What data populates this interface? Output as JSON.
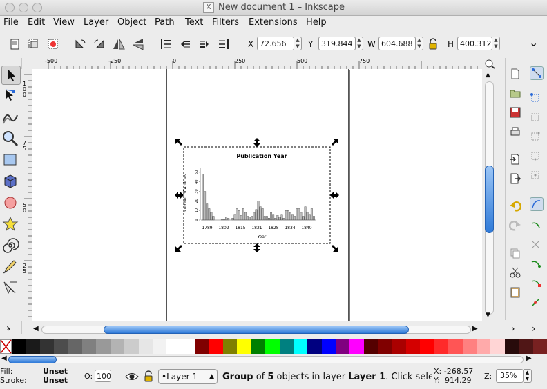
{
  "window": {
    "title": "New document 1 – Inkscape",
    "x11_badge": "X"
  },
  "menu": {
    "items": [
      {
        "label": "File",
        "key": "F",
        "rest": "ile"
      },
      {
        "label": "Edit",
        "key": "E",
        "rest": "dit"
      },
      {
        "label": "View",
        "key": "V",
        "rest": "iew"
      },
      {
        "label": "Layer",
        "key": "L",
        "rest": "ayer"
      },
      {
        "label": "Object",
        "key": "O",
        "rest": "bject"
      },
      {
        "label": "Path",
        "key": "P",
        "rest": "ath"
      },
      {
        "label": "Text",
        "key": "T",
        "rest": "ext"
      },
      {
        "label": "Filters",
        "key": "i",
        "pre": "F",
        "rest": "lters"
      },
      {
        "label": "Extensions",
        "key": "x",
        "pre": "E",
        "rest": "tensions"
      },
      {
        "label": "Help",
        "key": "H",
        "rest": "elp"
      }
    ]
  },
  "controls": {
    "x_label": "X",
    "x_value": "72.656",
    "y_label": "Y",
    "y_value": "319.844",
    "w_label": "W",
    "w_value": "604.688",
    "h_label": "H",
    "h_value": "400.312",
    "overflow": "⌄"
  },
  "ruler": {
    "h_labels": [
      "-500",
      "-250",
      "0",
      "250",
      "500",
      "750"
    ],
    "v_labels": [
      "1 0 0",
      "7 5",
      "5 0",
      "2 5"
    ]
  },
  "chart_data": {
    "type": "bar",
    "title": "Publication Year",
    "xlabel": "Year",
    "ylabel": "Number of Articles",
    "ylim": [
      0,
      55
    ],
    "yticks": [
      "0",
      "10",
      "20",
      "30",
      "40",
      "50"
    ],
    "xtick_labels": [
      "1789",
      "1802",
      "1815",
      "1821",
      "1828",
      "1834",
      "1840"
    ],
    "values": [
      48,
      30,
      17,
      12,
      8,
      4,
      0,
      0,
      0,
      1,
      1,
      3,
      2,
      0,
      2,
      6,
      12,
      10,
      5,
      12,
      8,
      4,
      3,
      4,
      8,
      11,
      20,
      14,
      12,
      4,
      4,
      2,
      8,
      6,
      2,
      5,
      3,
      6,
      2,
      10,
      10,
      8,
      6,
      4,
      12,
      12,
      8,
      4,
      14,
      8,
      6,
      12,
      4
    ]
  },
  "palette": {
    "colors": [
      "#000000",
      "#1a1a1a",
      "#333333",
      "#4d4d4d",
      "#666666",
      "#808080",
      "#999999",
      "#b3b3b3",
      "#cccccc",
      "#e6e6e6",
      "#f2f2f2",
      "#ffffff",
      "#ffffff",
      "#800000",
      "#ff0000",
      "#808000",
      "#ffff00",
      "#008000",
      "#00ff00",
      "#008080",
      "#00ffff",
      "#000080",
      "#0000ff",
      "#800080",
      "#ff00ff",
      "#550000",
      "#800000",
      "#aa0000",
      "#d40000",
      "#ff0000",
      "#ff2a2a",
      "#ff5555",
      "#ff8080",
      "#ffaaaa",
      "#ffd5d5",
      "#280b0b",
      "#501616",
      "#782121"
    ]
  },
  "status": {
    "fill_label": "Fill:",
    "fill_value": "Unset",
    "stroke_label": "Stroke:",
    "stroke_value": "Unset",
    "opacity_label": "O:",
    "opacity_value": "100",
    "layer_value": "•Layer 1",
    "message_pre": "Group",
    "message_mid": " of ",
    "message_count": "5",
    "message_post": " objects in layer ",
    "message_layer": "Layer 1",
    "message_tail": ". Click sele",
    "cursor_x": "X: -268.57",
    "cursor_y": "Y:  914.29",
    "zoom_label": "Z:",
    "zoom_value": "35%"
  }
}
